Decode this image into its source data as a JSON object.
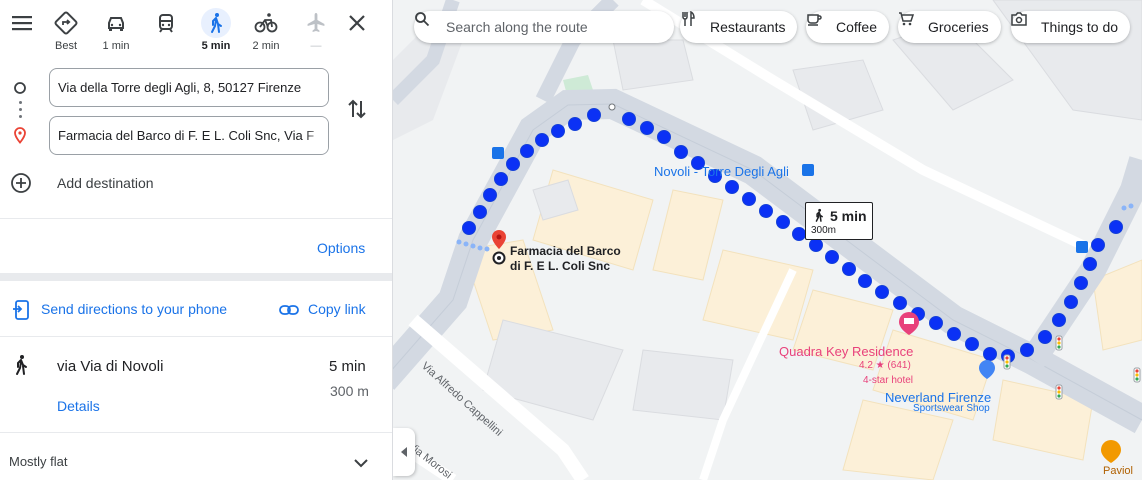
{
  "travel_modes": [
    {
      "name": "Best",
      "label": "Best"
    },
    {
      "name": "Driving",
      "label": "1 min"
    },
    {
      "name": "Transit",
      "label": ""
    },
    {
      "name": "Walking",
      "label": "5 min"
    },
    {
      "name": "Cycling",
      "label": "2 min"
    },
    {
      "name": "Flights",
      "label": "—"
    }
  ],
  "active_mode": "Walking",
  "route": {
    "origin": "Via della Torre degli Agli, 8, 50127 Firenze",
    "destination": "Farmacia del Barco di F. E L. Coli Snc, Via F",
    "add_destination": "Add destination"
  },
  "options_label": "Options",
  "share": {
    "send_label": "Send directions to your phone",
    "copy_label": "Copy link"
  },
  "trip": {
    "via": "via Via di Novoli",
    "time": "5 min",
    "distance": "300 m",
    "details_label": "Details"
  },
  "terrain": "Mostly flat",
  "map": {
    "search_placeholder": "Search along the route",
    "chips": [
      "Restaurants",
      "Coffee",
      "Groceries",
      "Things to do"
    ],
    "callout_time": "5 min",
    "callout_distance": "300m",
    "dest_pin_label_1": "Farmacia del Barco",
    "dest_pin_label_2": "di F. E L. Coli Snc",
    "poi_street_main": "Novoli - Torre Degli Agli",
    "poi_hotel_name": "Quadra Key Residence",
    "poi_hotel_rating": "4.2 ★ (641)",
    "poi_hotel_class": "4-star hotel",
    "poi_shop_name": "Neverland Firenze",
    "poi_shop_type": "Sportswear Shop",
    "street_1": "Via Alfredo Cappellini",
    "street_2": "Via Morosi",
    "poi_edge": "Paviol"
  },
  "colors": {
    "accent": "#1a73e8",
    "route": "#0b31f5",
    "pin": "#ea4335",
    "hotel": "#e8417b"
  },
  "icons": [
    "menu-icon",
    "diamond-turn-icon",
    "car-icon",
    "train-icon",
    "walk-icon",
    "bike-icon",
    "plane-icon",
    "close-icon",
    "swap-icon",
    "add-circle-icon",
    "phone-send-icon",
    "link-icon",
    "walk-icon",
    "chevron-down-icon",
    "search-icon",
    "fork-knife-icon",
    "coffee-cup-icon",
    "cart-icon",
    "camera-icon"
  ]
}
